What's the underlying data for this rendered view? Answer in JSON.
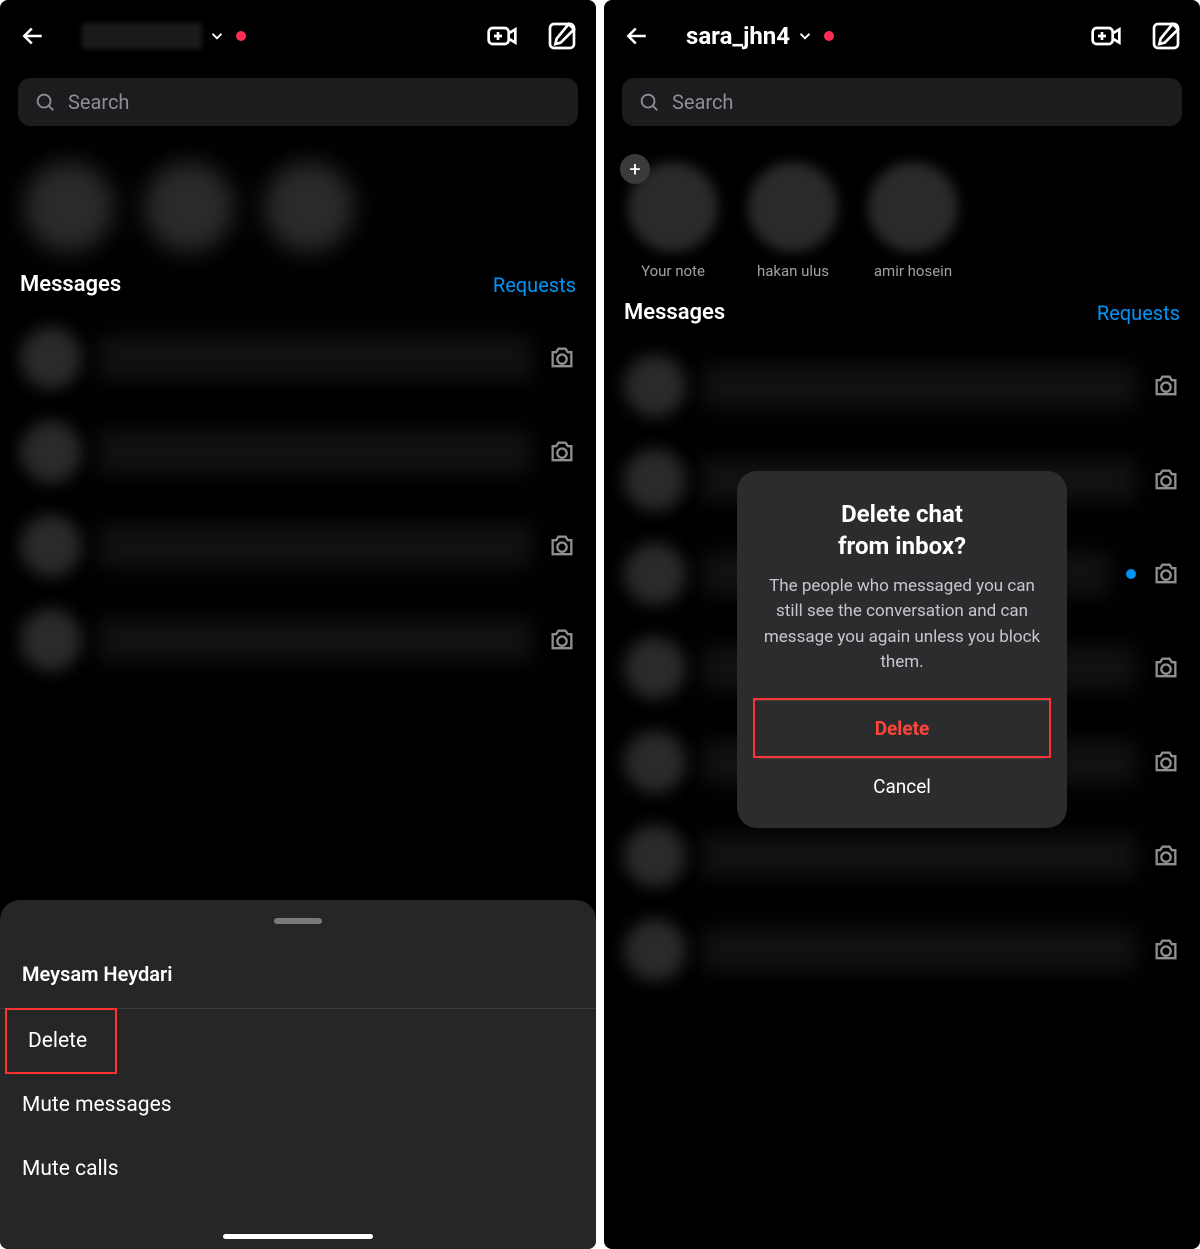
{
  "left": {
    "search_placeholder": "Search",
    "messages_label": "Messages",
    "requests_label": "Requests",
    "sheet": {
      "contact_name": "Meysam Heydari",
      "delete": "Delete",
      "mute_messages": "Mute messages",
      "mute_calls": "Mute calls"
    }
  },
  "right": {
    "username": "sara_jhn4",
    "search_placeholder": "Search",
    "notes": {
      "your_note": "Your note",
      "n1": "hakan ulus",
      "n2": "amir hosein"
    },
    "messages_label": "Messages",
    "requests_label": "Requests",
    "dialog": {
      "title_l1": "Delete chat",
      "title_l2": "from inbox?",
      "body": "The people who messaged you can still see the conversation and can message you again unless you block them.",
      "delete": "Delete",
      "cancel": "Cancel"
    }
  }
}
